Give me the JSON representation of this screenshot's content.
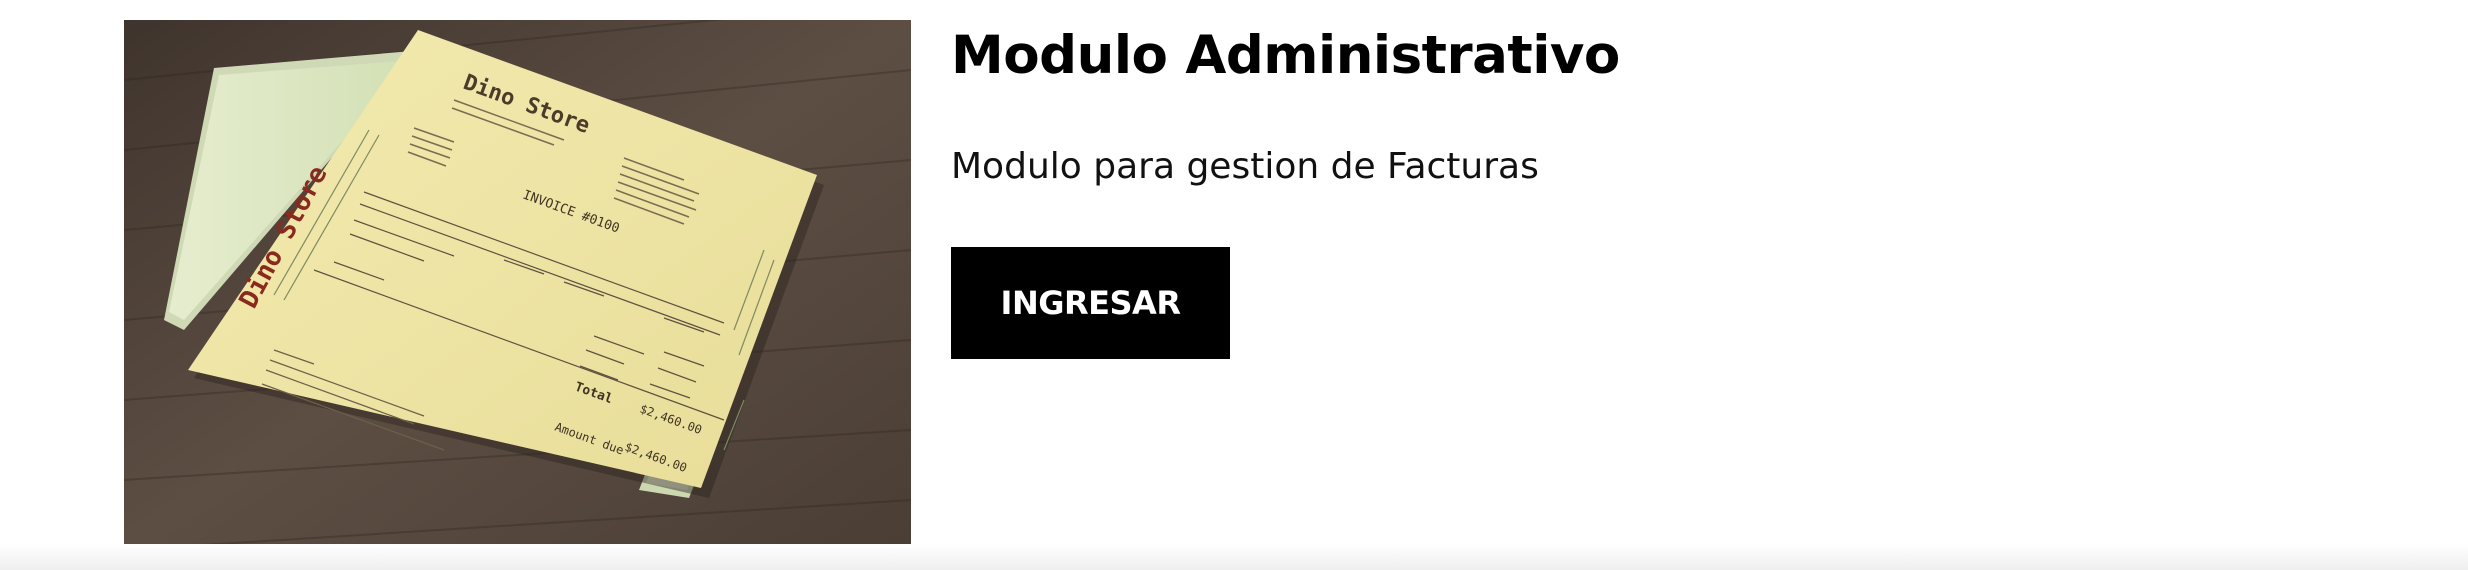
{
  "module": {
    "title": "Modulo Administrativo",
    "description": "Modulo para gestion de Facturas",
    "button_label": "INGRESAR",
    "image_alt": "Mockup de facturas Dino Store"
  },
  "invoice_mockup": {
    "brand": "Dino Store",
    "doc_title": "INVOICE #0100",
    "total_label": "Total",
    "total_value": "$2,460.00",
    "amount_due_label": "Amount due",
    "amount_due_value": "$2,460.00"
  },
  "colors": {
    "button_bg": "#000000",
    "button_text": "#ffffff",
    "title": "#000000",
    "paper_yellow": "#efe6a6",
    "paper_green": "#dfe8c4",
    "brand_red": "#8a2a1e"
  }
}
